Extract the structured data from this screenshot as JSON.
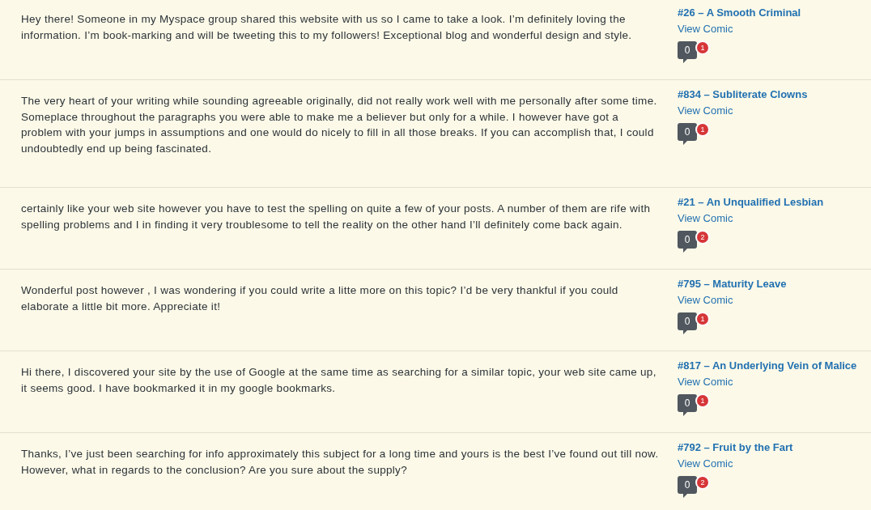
{
  "comments": [
    {
      "unapproved": true,
      "text": "Hey there! Someone in my Myspace group shared this website with us so I came to take a look. I’m definitely loving the information. I’m book-marking and will be tweeting this to my followers! Exceptional blog and wonderful design and style.",
      "post": {
        "title": "#26 – A Smooth Criminal",
        "view_link": "View Comic",
        "approved_count": "0",
        "pending_count": "1"
      }
    },
    {
      "unapproved": true,
      "text": "The very heart of your writing while sounding agreeable originally, did not really work well with me personally after some time. Someplace throughout the paragraphs you were able to make me a believer but only for a while. I however have got a problem with your jumps in assumptions and one would do nicely to fill in all those breaks. If you can accomplish that, I could undoubtedly end up being fascinated.",
      "post": {
        "title": "#834 – Subliterate Clowns",
        "view_link": "View Comic",
        "approved_count": "0",
        "pending_count": "1"
      }
    },
    {
      "unapproved": true,
      "text": "certainly like your web site however you have to test the spelling on quite a few of your posts. A number of them are rife with spelling problems and I in finding it very troublesome to tell the reality on the other hand I’ll definitely come back again.",
      "post": {
        "title": "#21 – An Unqualified Lesbian",
        "view_link": "View Comic",
        "approved_count": "0",
        "pending_count": "2"
      }
    },
    {
      "unapproved": true,
      "text": "Wonderful post however , I was wondering if you could write a litte more on this topic? I’d be very thankful if you could elaborate a little bit more. Appreciate it!",
      "post": {
        "title": "#795 – Maturity Leave",
        "view_link": "View Comic",
        "approved_count": "0",
        "pending_count": "1"
      }
    },
    {
      "unapproved": true,
      "text": "Hi there, I discovered your site by the use of Google at the same time as searching for a similar topic, your web site came up, it seems good. I have bookmarked it in my google bookmarks.",
      "post": {
        "title": "#817 – An Underlying Vein of Malice",
        "view_link": "View Comic",
        "approved_count": "0",
        "pending_count": "1"
      }
    },
    {
      "unapproved": true,
      "text": "Thanks, I’ve just been searching for info approximately this subject for a long time and yours is the best I’ve found out till now. However, what in regards to the conclusion? Are you sure about the supply?",
      "post": {
        "title": "#792 – Fruit by the Fart",
        "view_link": "View Comic",
        "approved_count": "0",
        "pending_count": "2"
      }
    }
  ]
}
